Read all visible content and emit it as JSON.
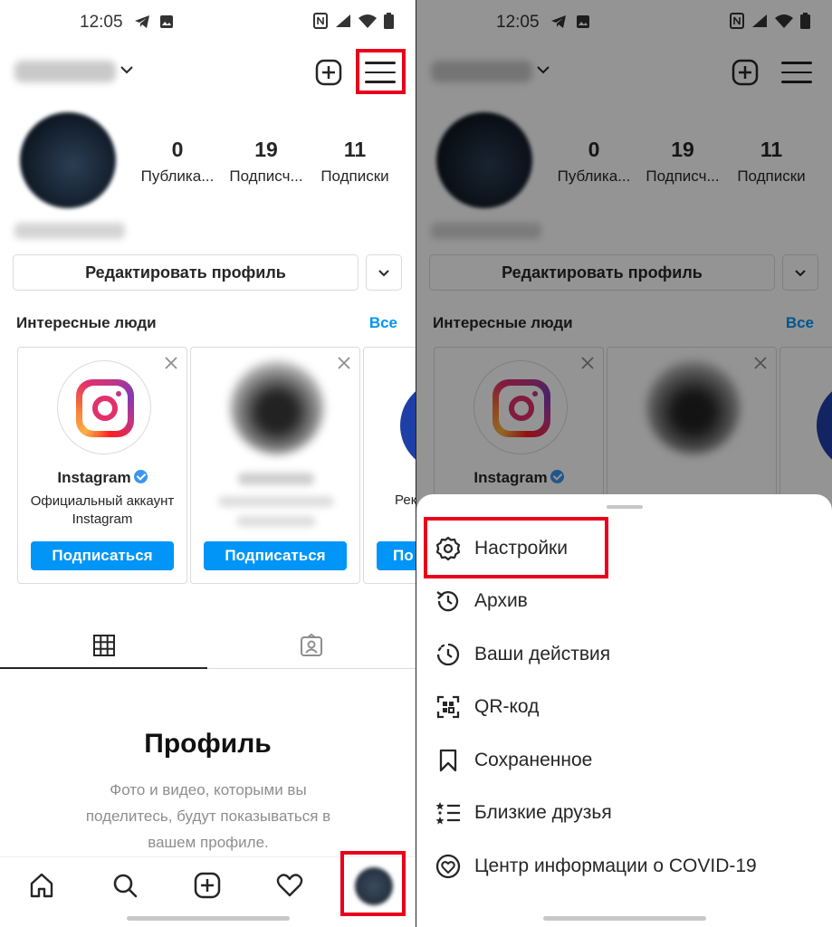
{
  "status": {
    "time": "12:05"
  },
  "profile": {
    "stats": [
      {
        "number": "0",
        "label": "Публика..."
      },
      {
        "number": "19",
        "label": "Подписч..."
      },
      {
        "number": "11",
        "label": "Подписки"
      }
    ],
    "edit_label": "Редактировать профиль"
  },
  "discover": {
    "title": "Интересные люди",
    "all_label": "Все",
    "cards": [
      {
        "name": "Instagram",
        "desc": "Официальный аккаунт Instagram",
        "follow": "Подписаться"
      },
      {
        "name": "",
        "desc": "",
        "follow": "Подписаться"
      },
      {
        "name": "",
        "desc": "Рек",
        "follow": "По"
      }
    ]
  },
  "empty": {
    "title": "Профиль",
    "desc": "Фото и видео, которыми вы поделитесь, будут показываться в вашем профиле."
  },
  "menu": {
    "items": [
      {
        "label": "Настройки",
        "icon": "gear-icon"
      },
      {
        "label": "Архив",
        "icon": "archive-icon"
      },
      {
        "label": "Ваши действия",
        "icon": "activity-icon"
      },
      {
        "label": "QR-код",
        "icon": "qr-code-icon"
      },
      {
        "label": "Сохраненное",
        "icon": "bookmark-icon"
      },
      {
        "label": "Близкие друзья",
        "icon": "close-friends-icon"
      },
      {
        "label": "Центр информации о COVID-19",
        "icon": "covid-info-icon"
      }
    ]
  },
  "colors": {
    "accent": "#0095f6",
    "highlight": "#e8001c"
  }
}
